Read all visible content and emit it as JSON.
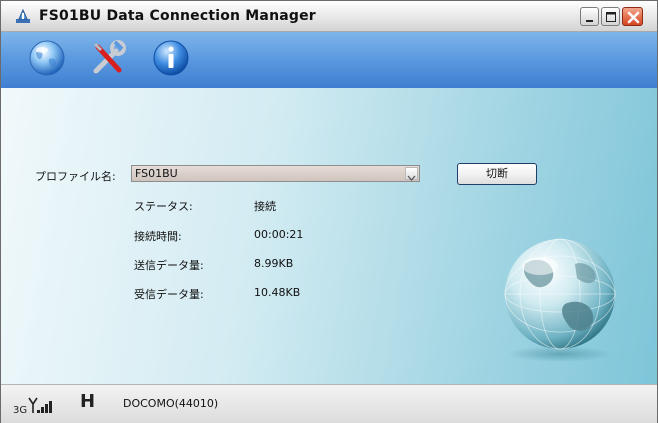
{
  "window": {
    "title": "FS01BU Data Connection Manager"
  },
  "toolbar": {
    "buttons": [
      {
        "icon": "globe-icon"
      },
      {
        "icon": "tools-icon"
      },
      {
        "icon": "info-icon"
      }
    ]
  },
  "profile": {
    "label": "プロファイル名:",
    "selected": "FS01BU",
    "disconnect_label": "切断"
  },
  "stats": [
    {
      "label": "ステータス:",
      "value": "接続"
    },
    {
      "label": "接続時間:",
      "value": "00:00:21"
    },
    {
      "label": "送信データ量:",
      "value": "8.99KB"
    },
    {
      "label": "受信データ量:",
      "value": "10.48KB"
    }
  ],
  "status_bar": {
    "network_type": "3G",
    "signal_bars": 4,
    "hspa_indicator": "H",
    "carrier": "DOCOMO(44010)"
  },
  "colors": {
    "toolbar_blue": "#5a98df",
    "close_red": "#d6451e",
    "content_bg": "#d2ebf2"
  }
}
